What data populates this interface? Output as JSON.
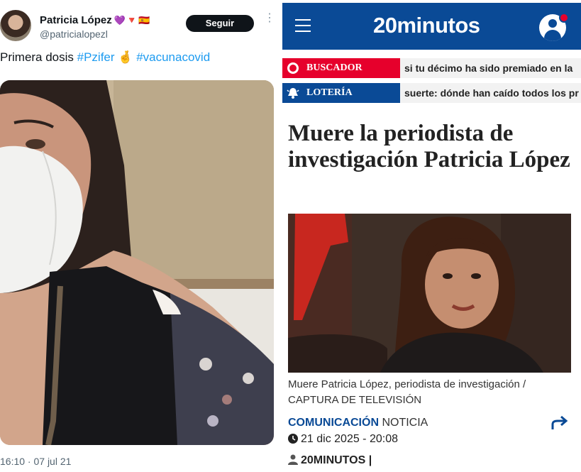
{
  "tweet": {
    "display_name": "Patricia López",
    "name_emojis": "💜🔻🇪🇸",
    "handle": "@patricialopezl",
    "follow_label": "Seguir",
    "more_label": "⋮",
    "text_plain": "Primera dosis ",
    "hashtag1": "#Pzifer",
    "emoji_mid": " 🤞",
    "hashtag2": "#vacunacovid",
    "timestamp": "16:10 · 07 jul 21"
  },
  "news": {
    "logo": "20minutos",
    "ticker": [
      {
        "label": "BUSCADOR",
        "text": "si tu décimo ha sido premiado en la",
        "color": "#e6002c"
      },
      {
        "label": "LOTERÍA",
        "text": "suerte: dónde han caído todos los pr",
        "color": "#0a4a96"
      }
    ],
    "headline": "Muere la periodista de investigación Patricia López",
    "caption": "Muere Patricia López, periodista de investigación / CAPTURA DE TELEVISIÓN",
    "section": "COMUNICACIÓN",
    "type": "NOTICIA",
    "date": "21 dic 2025 - 20:08",
    "author": "20MINUTOS |"
  },
  "colors": {
    "brand_blue": "#0a4a96",
    "brand_red": "#e6002c",
    "twitter_blue": "#1d9bf0"
  }
}
